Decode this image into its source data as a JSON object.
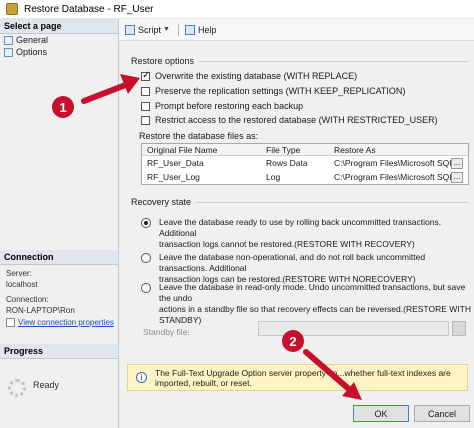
{
  "window": {
    "title": "Restore Database - RF_User"
  },
  "sidebar": {
    "select_page_header": "Select a page",
    "pages": [
      {
        "label": "General"
      },
      {
        "label": "Options"
      }
    ],
    "connection_header": "Connection",
    "server_label": "Server:",
    "server_value": "localhost",
    "connection_label": "Connection:",
    "connection_value": "RON-LAPTOP\\Ron",
    "view_connection": "View connection properties",
    "progress_header": "Progress",
    "progress_status": "Ready"
  },
  "toolbar": {
    "script_label": "Script",
    "help_label": "Help"
  },
  "restore_options": {
    "header": "Restore options",
    "items": [
      {
        "label": "Overwrite the existing database (WITH REPLACE)",
        "checked": true
      },
      {
        "label": "Preserve the replication settings (WITH KEEP_REPLICATION)",
        "checked": false
      },
      {
        "label": "Prompt before restoring each backup",
        "checked": false
      },
      {
        "label": "Restrict access to the restored database (WITH RESTRICTED_USER)",
        "checked": false
      }
    ]
  },
  "files": {
    "label": "Restore the database files as:",
    "columns": [
      "Original File Name",
      "File Type",
      "Restore As"
    ],
    "rows": [
      [
        "RF_User_Data",
        "Rows Data",
        "C:\\Program Files\\Microsoft SQL..."
      ],
      [
        "RF_User_Log",
        "Log",
        "C:\\Program Files\\Microsoft SQL..."
      ]
    ],
    "ellipsis": "..."
  },
  "recovery": {
    "header": "Recovery state",
    "options": [
      {
        "line1": "Leave the database ready to use by rolling back uncommitted transactions. Additional",
        "line2": "transaction logs cannot be restored.(RESTORE WITH RECOVERY)",
        "line3": "",
        "selected": true
      },
      {
        "line1": "Leave the database non-operational, and do not roll back uncommitted transactions. Additional",
        "line2": "transaction logs can be restored.(RESTORE WITH NORECOVERY)",
        "line3": "",
        "selected": false
      },
      {
        "line1": "Leave the database in read-only mode. Undo uncommitted transactions, but save the undo",
        "line2": "actions in a standby file so that recovery effects can be reversed.(RESTORE WITH",
        "line3": "STANDBY)",
        "selected": false
      }
    ],
    "standby_label": "Standby file:"
  },
  "info": {
    "line1": "The Full-Text Upgrade Option server property co...whether full-text indexes are",
    "line2": "imported, rebuilt, or reset."
  },
  "buttons": {
    "ok": "OK",
    "cancel": "Cancel"
  },
  "callouts": {
    "first": "1",
    "second": "2"
  },
  "colors": {
    "callout": "#c8102e",
    "info_bg": "#fdf3c5",
    "link": "#1a52b8"
  }
}
